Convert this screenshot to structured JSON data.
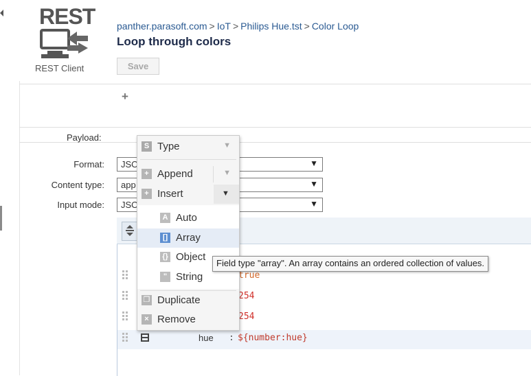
{
  "logo": {
    "text": "REST",
    "label": "REST Client",
    "icon": "rest-client-icon"
  },
  "breadcrumb": [
    "panther.parasoft.com",
    "IoT",
    "Philips Hue.tst",
    "Color Loop"
  ],
  "breadcrumb_separator": ">",
  "title": "Loop through colors",
  "save_label": "Save",
  "add_symbol": "+",
  "payload_label": "Payload:",
  "fields": {
    "format": {
      "label": "Format:",
      "value": "JSO"
    },
    "content_type": {
      "label": "Content type:",
      "value": "app"
    },
    "input_mode": {
      "label": "Input mode:",
      "value": "JSO"
    }
  },
  "tree_rows": [
    {
      "value": "true"
    },
    {
      "value": "254"
    },
    {
      "value": "254"
    },
    {
      "key": "hue",
      "separator": ":",
      "value": "${number:hue}"
    }
  ],
  "menu": {
    "type": {
      "icon": "S",
      "label": "Type"
    },
    "append": {
      "label": "Append"
    },
    "insert": {
      "label": "Insert"
    },
    "types": [
      {
        "icon": "A",
        "label": "Auto"
      },
      {
        "icon": "[]",
        "label": "Array",
        "selected": true
      },
      {
        "icon": "{}",
        "label": "Object"
      },
      {
        "icon": "\"",
        "label": "String"
      }
    ],
    "duplicate": {
      "label": "Duplicate"
    },
    "remove": {
      "label": "Remove"
    }
  },
  "tooltip": "Field type \"array\". An array contains an ordered collection of values.",
  "colors": {
    "link": "#2a5a92",
    "title": "#1e2b4a",
    "accent": "#5d8fd1",
    "value_red": "#d0302a",
    "value_orange": "#d3682a"
  }
}
